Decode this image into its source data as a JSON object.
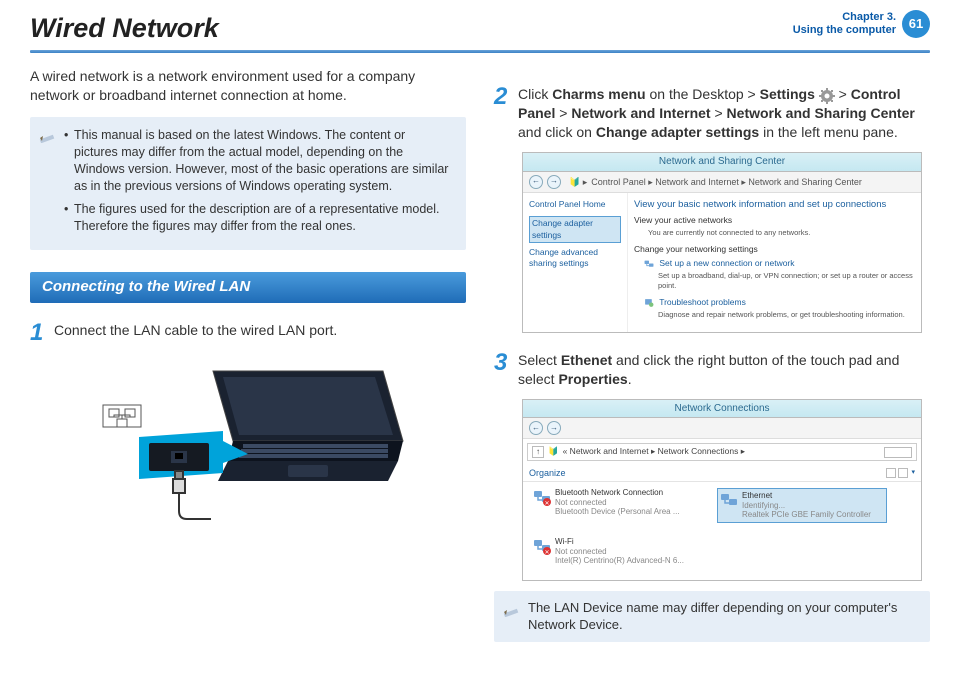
{
  "header": {
    "title": "Wired Network",
    "chapter_line1": "Chapter 3.",
    "chapter_line2": "Using the computer",
    "page_number": "61"
  },
  "intro": "A wired network is a network environment used for a company network or broadband internet connection at home.",
  "note1": {
    "items": [
      "This manual is based on the latest Windows. The content or pictures may differ from the actual model, depending on the Windows version. However, most of the basic operations are similar as in the previous versions of Windows operating system.",
      "The figures used for the description are of a representative model. Therefore the figures may differ from the real ones."
    ]
  },
  "section_title": "Connecting to the Wired LAN",
  "step1": {
    "num": "1",
    "text": "Connect the LAN cable to the wired LAN port."
  },
  "step2": {
    "num": "2",
    "prefix": "Click ",
    "b1": "Charms menu",
    "mid1": " on the Desktop > ",
    "b2": "Settings",
    "mid2": " > ",
    "b3": "Control Panel",
    "mid3": " > ",
    "b4": "Network and Internet",
    "mid4": " > ",
    "b5": "Network and Sharing Center",
    "mid5": " and click on ",
    "b6": "Change adapter settings",
    "suffix": " in the left menu pane."
  },
  "nsc": {
    "title": "Network and Sharing Center",
    "crumb": "Control Panel  ▸  Network and Internet  ▸  Network and Sharing Center",
    "side_home": "Control Panel Home",
    "side_sel": "Change adapter settings",
    "side_other": "Change advanced sharing settings",
    "h1": "View your basic network information and set up connections",
    "active": "View your active networks",
    "active_sub": "You are currently not connected to any networks.",
    "change": "Change your networking settings",
    "opt1": "Set up a new connection or network",
    "opt1_sub": "Set up a broadband, dial-up, or VPN connection; or set up a router or access point.",
    "opt2": "Troubleshoot problems",
    "opt2_sub": "Diagnose and repair network problems, or get troubleshooting information."
  },
  "step3": {
    "num": "3",
    "prefix": "Select ",
    "b1": "Ethenet",
    "mid": " and click the right button of the touch pad and select ",
    "b2": "Properties",
    "suffix": "."
  },
  "nc": {
    "title": "Network Connections",
    "crumb": "«  Network and Internet  ▸  Network Connections  ▸",
    "organize": "Organize",
    "items": [
      {
        "name": "Bluetooth Network Connection",
        "status": "Not connected",
        "dev": "Bluetooth Device (Personal Area ...",
        "x": true
      },
      {
        "name": "Ethernet",
        "status": "Identifying...",
        "dev": "Realtek PCIe GBE Family Controller",
        "sel": true
      },
      {
        "name": "Wi-Fi",
        "status": "Not connected",
        "dev": "Intel(R) Centrino(R) Advanced-N 6...",
        "x": true
      }
    ]
  },
  "note2": "The LAN Device name may differ depending on your computer's Network Device."
}
